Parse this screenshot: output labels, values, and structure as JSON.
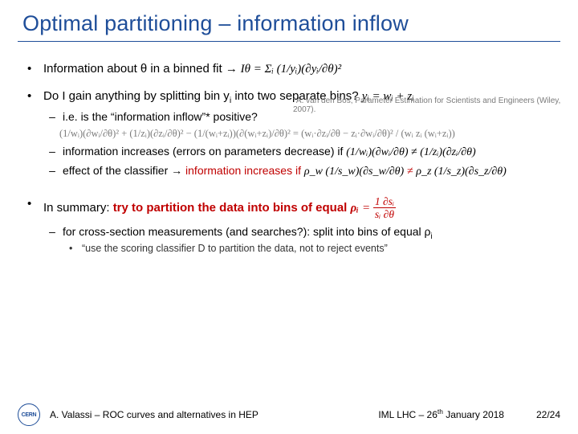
{
  "title": "Optimal partitioning – information inflow",
  "footnote_mark": "*",
  "footnote_text": "A. van den Bos, Parameter Estimation for Scientists and Engineers (Wiley, 2007).",
  "b1_a": "Information about θ in a binned fit",
  "b1_b": " → ",
  "b1_eq": "Iθ = Σᵢ (1/yᵢ)(∂yᵢ/∂θ)²",
  "b2_a": "Do I gain anything by splitting bin y",
  "b2_b": " into two separate bins? ",
  "b2_eq": "yᵢ = wᵢ + zᵢ",
  "sub2_a": "i.e. is the “information inflow”",
  "sub2_b": " positive?",
  "deriv_eq": "(1/wᵢ)(∂wᵢ/∂θ)² + (1/zᵢ)(∂zᵢ/∂θ)² − (1/(wᵢ+zᵢ))(∂(wᵢ+zᵢ)/∂θ)²  =  (wᵢ·∂zᵢ/∂θ − zᵢ·∂wᵢ/∂θ)² / (wᵢ zᵢ (wᵢ+zᵢ))",
  "sub3_a": "information increases (errors on parameters decrease) if ",
  "sub3_eq": "(1/wᵢ)(∂wᵢ/∂θ) ≠ (1/zᵢ)(∂zᵢ/∂θ)",
  "sub4_a": "effect of the classifier",
  "sub4_b": " → ",
  "sub4_c": "information increases if ",
  "sub4_eq_lhs": "ρ_w (1/s_w)(∂s_w/∂θ)",
  "sub4_neq": " ≠ ",
  "sub4_eq_rhs": "ρ_z (1/s_z)(∂s_z/∂θ)",
  "b3_a": "In summary: ",
  "b3_b": "try to partition the data into bins of equal ",
  "b3_eq_rho": "ρᵢ",
  "b3_eq_rhs_n": "1 ∂sᵢ",
  "b3_eq_rhs_d": "sᵢ ∂θ",
  "sub5_a": "for cross-section measurements (and searches?): split into bins of equal ρ",
  "quote_a": "“use the scoring classifier D to partition the data, not to reject events”",
  "footer_left": "A. Valassi – ROC curves and alternatives in HEP",
  "footer_mid_a": "IML LHC – 26",
  "footer_mid_sup": "th",
  "footer_mid_b": " January 2018",
  "footer_right": "22/24",
  "logo_text": "CERN"
}
